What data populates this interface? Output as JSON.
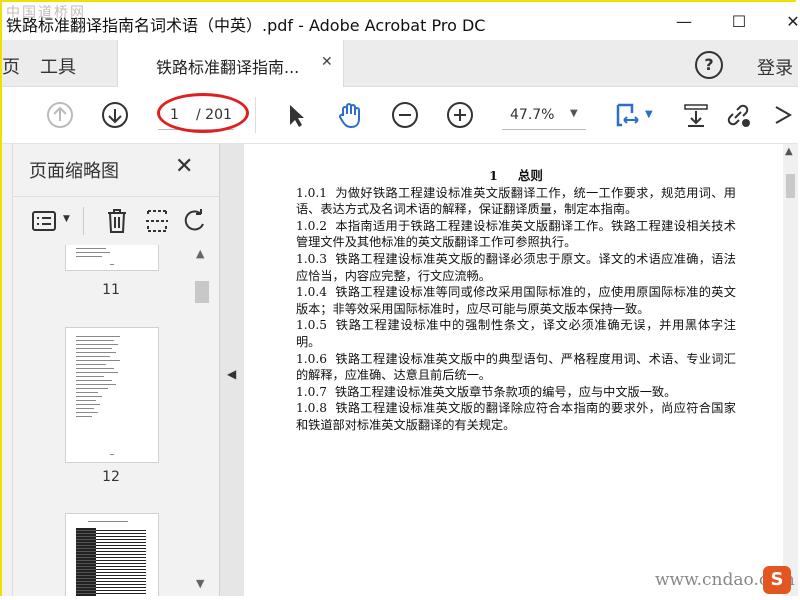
{
  "window": {
    "title": "铁路标准翻译指南名词术语（中英）.pdf - Adobe Acrobat Pro DC",
    "watermark_top": "中国道桥网",
    "minimize": "—",
    "maximize": "☐",
    "close": "✕"
  },
  "tabs": {
    "home": "页",
    "tools": "工具",
    "document": "铁路标准翻译指南...",
    "document_close": "✕",
    "help": "?",
    "login": "登录"
  },
  "toolbar": {
    "current_page": "1",
    "total_pages": "/ 201",
    "zoom": "47.7%",
    "icons": [
      "up-arrow-icon",
      "down-arrow-icon",
      "select-pointer-icon",
      "hand-icon",
      "zoom-out-icon",
      "zoom-in-icon",
      "page-fit-icon",
      "download-icon",
      "link-icon"
    ]
  },
  "sidebar": {
    "title": "页面缩略图",
    "close": "✕",
    "thumbnails": [
      {
        "label": "11"
      },
      {
        "label": "12"
      },
      {
        "label": ""
      }
    ]
  },
  "document": {
    "heading_num": "1",
    "heading": "总则",
    "paragraphs": [
      {
        "num": "1.0.1",
        "text": "为做好铁路工程建设标准英文版翻译工作，统一工作要求，规范用词、用语、表达方式及名词术语的解释，保证翻译质量，制定本指南。"
      },
      {
        "num": "1.0.2",
        "text": "本指南适用于铁路工程建设标准英文版翻译工作。铁路工程建设相关技术管理文件及其他标准的英文版翻译工作可参照执行。"
      },
      {
        "num": "1.0.3",
        "text": "铁路工程建设标准英文版的翻译必须忠于原文。译文的术语应准确，语法应恰当，内容应完整，行文应流畅。"
      },
      {
        "num": "1.0.4",
        "text": "铁路工程建设标准等同或修改采用国际标准的，应使用原国际标准的英文版本；非等效采用国际标准时，应尽可能与原英文版本保持一致。"
      },
      {
        "num": "1.0.5",
        "text": "铁路工程建设标准中的强制性条文，译文必须准确无误，并用黑体字注明。"
      },
      {
        "num": "1.0.6",
        "text": "铁路工程建设标准英文版中的典型语句、严格程度用词、术语、专业词汇的解释，应准确、达意且前后统一。"
      },
      {
        "num": "1.0.7",
        "text": "铁路工程建设标准英文版章节条款项的编号，应与中文版一致。"
      },
      {
        "num": "1.0.8",
        "text": "铁路工程建设标准英文版的翻译除应符合本指南的要求外，尚应符合国家和铁道部对标准英文版翻译的有关规定。"
      }
    ]
  },
  "watermark_bottom": "www.cndao.com",
  "logo_letter": "S",
  "colors": {
    "accent_blue": "#2a6fc9",
    "highlight_red": "#e02020",
    "frame_yellow": "#f0e000"
  }
}
